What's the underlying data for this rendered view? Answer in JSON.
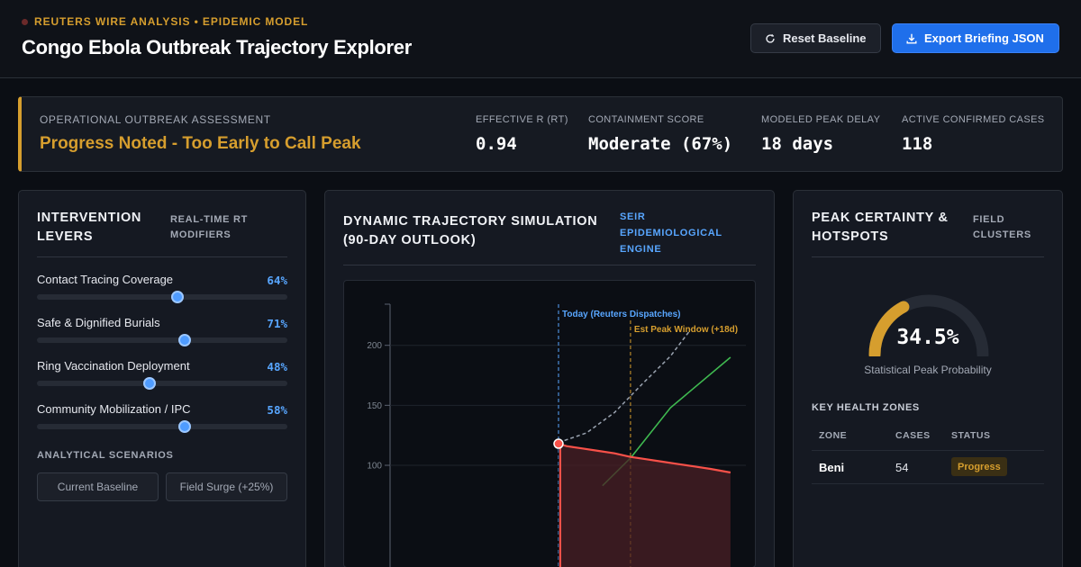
{
  "header": {
    "eyebrow": "REUTERS WIRE ANALYSIS • EPIDEMIC MODEL",
    "title": "Congo Ebola Outbreak Trajectory Explorer",
    "reset_label": "Reset Baseline",
    "export_label": "Export Briefing JSON"
  },
  "assessment": {
    "label": "OPERATIONAL OUTBREAK ASSESSMENT",
    "status": "Progress Noted - Too Early to Call Peak",
    "metrics": [
      {
        "label": "EFFECTIVE R (RT)",
        "value": "0.94"
      },
      {
        "label": "CONTAINMENT SCORE",
        "value": "Moderate (67%)"
      },
      {
        "label": "MODELED PEAK DELAY",
        "value": "18 days"
      },
      {
        "label": "ACTIVE CONFIRMED CASES",
        "value": "118"
      }
    ]
  },
  "levers": {
    "title_line1": "INTERVENTION",
    "title_line2": "LEVERS",
    "sub_line1": "REAL-TIME RT",
    "sub_line2": "MODIFIERS",
    "items": [
      {
        "label": "Contact Tracing Coverage",
        "value_text": "64%",
        "level": 0.56
      },
      {
        "label": "Safe & Dignified Burials",
        "value_text": "71%",
        "level": 0.59
      },
      {
        "label": "Ring Vaccination Deployment",
        "value_text": "48%",
        "level": 0.45
      },
      {
        "label": "Community Mobilization / IPC",
        "value_text": "58%",
        "level": 0.59
      }
    ],
    "scenarios_label": "ANALYTICAL SCENARIOS",
    "scenarios": [
      "Current Baseline",
      "Field Surge (+25%)"
    ]
  },
  "simulation": {
    "title_line1": "DYNAMIC TRAJECTORY SIMULATION",
    "title_line2": "(90-DAY OUTLOOK)",
    "engine_line1": "SEIR",
    "engine_line2": "EPIDEMIOLOGICAL",
    "engine_line3": "ENGINE"
  },
  "chart_data": {
    "type": "line",
    "ylim": [
      90,
      210
    ],
    "y_ticks": [
      100,
      150,
      200
    ],
    "x_today": 0,
    "x_peak": 18,
    "annotations": [
      {
        "label": "Today (Reuters Dispatches)",
        "x": 0
      },
      {
        "label": "Est Peak Window (+18d)",
        "x": 18
      }
    ],
    "series": [
      {
        "style": "dashed",
        "color": "#9aa3b0",
        "points": [
          [
            0,
            119
          ],
          [
            7,
            127
          ],
          [
            14,
            144
          ],
          [
            21,
            168
          ],
          [
            28,
            191
          ],
          [
            33,
            213
          ]
        ]
      },
      {
        "style": "solid",
        "color": "#3fb950",
        "points": [
          [
            11,
            83
          ],
          [
            18,
            106
          ],
          [
            28,
            148
          ],
          [
            43,
            190
          ]
        ]
      },
      {
        "style": "solid-fill",
        "color": "#f85149",
        "points": [
          [
            0,
            118
          ],
          [
            2,
            116
          ],
          [
            6,
            114
          ],
          [
            10,
            112
          ],
          [
            14,
            110
          ],
          [
            18,
            107
          ],
          [
            22,
            105
          ],
          [
            26,
            103
          ],
          [
            30,
            101
          ],
          [
            34,
            99
          ],
          [
            38,
            97
          ],
          [
            43,
            94
          ]
        ]
      }
    ]
  },
  "peak": {
    "title_line1": "PEAK CERTAINTY &",
    "title_line2": "HOTSPOTS",
    "sub_line1": "FIELD",
    "sub_line2": "CLUSTERS",
    "probability": 0.345,
    "probability_text": "34.5%",
    "probability_label": "Statistical Peak Probability",
    "zones_label": "KEY HEALTH ZONES",
    "columns": [
      "ZONE",
      "CASES",
      "STATUS"
    ],
    "rows": [
      {
        "zone": "Beni",
        "cases": "54",
        "status": "Progress"
      }
    ]
  },
  "colors": {
    "accent": "#d69e2e",
    "primary": "#1f6feb",
    "slider": "#4f9cff",
    "cases_line": "#f85149",
    "recovered_line": "#3fb950"
  }
}
